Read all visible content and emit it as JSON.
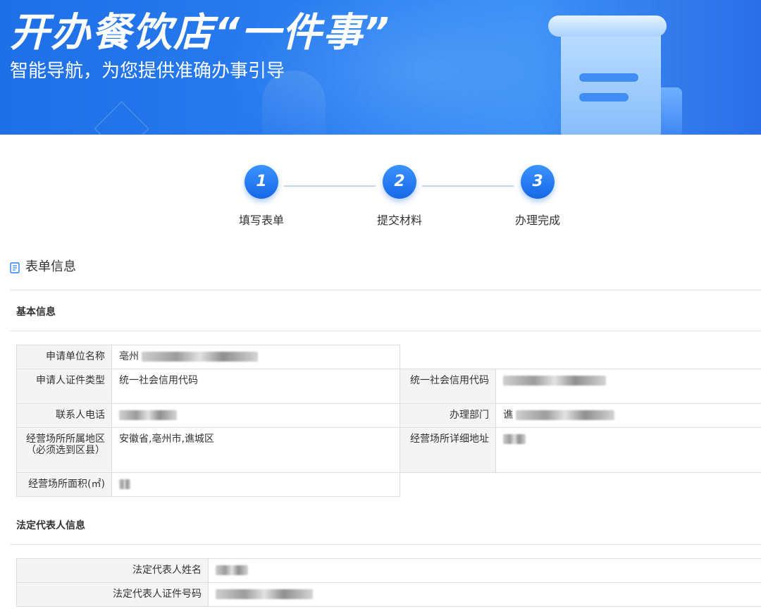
{
  "banner": {
    "title": "开办餐饮店“一件事”",
    "subtitle": "智能导航，为您提供准确办事引导"
  },
  "steps": [
    {
      "number": "1",
      "label": "填写表单"
    },
    {
      "number": "2",
      "label": "提交材料"
    },
    {
      "number": "3",
      "label": "办理完成"
    }
  ],
  "section": {
    "title": "表单信息",
    "icon": "document-icon"
  },
  "basic_info": {
    "title": "基本信息",
    "unit_name_label": "申请单位名称",
    "unit_name_value": "亳州",
    "id_type_label": "申请人证件类型",
    "id_type_value": "统一社会信用代码",
    "credit_code_label": "统一社会信用代码",
    "contact_phone_label": "联系人电话",
    "department_label": "办理部门",
    "department_value": "谯",
    "region_label": "经营场所所属地区（必须选到区县）",
    "region_value": "安徽省,亳州市,谯城区",
    "address_label": "经营场所详细地址",
    "area_label": "经营场所面积(㎡)"
  },
  "legal_rep": {
    "title": "法定代表人信息",
    "name_label": "法定代表人姓名",
    "id_number_label": "法定代表人证件号码"
  },
  "colors": {
    "brand_blue": "#1f6fe6",
    "label_bg": "#f4f4f4",
    "border": "#dedede"
  }
}
